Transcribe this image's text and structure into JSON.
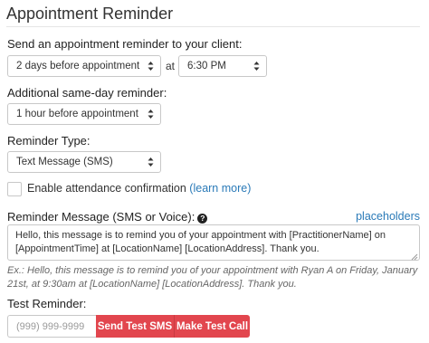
{
  "title": "Appointment Reminder",
  "reminder": {
    "label": "Send an appointment reminder to your client:",
    "timing_value": "2 days before appointment",
    "at_label": "at",
    "time_value": "6:30 PM"
  },
  "same_day": {
    "label": "Additional same-day reminder:",
    "value": "1 hour before appointment"
  },
  "reminder_type": {
    "label": "Reminder Type:",
    "value": "Text Message (SMS)"
  },
  "attendance": {
    "label": "Enable attendance confirmation",
    "link": "(learn more)",
    "checked": false
  },
  "message": {
    "label": "Reminder Message (SMS or Voice):",
    "help_glyph": "?",
    "placeholders_link": "placeholders",
    "value": "Hello, this message is to remind you of your appointment with [PractitionerName] on [AppointmentTime] at [LocationName] [LocationAddress]. Thank you.",
    "example": "Ex.: Hello, this message is to remind you of your appointment with Ryan A on Friday, January 21st, at 9:30am at [LocationName] [LocationAddress]. Thank you."
  },
  "test": {
    "label": "Test Reminder:",
    "phone_placeholder": "(999) 999-9999",
    "sms_button": "Send Test SMS",
    "call_button": "Make Test Call"
  },
  "colors": {
    "accent_button": "#e2464e",
    "link": "#2a7ab8"
  }
}
